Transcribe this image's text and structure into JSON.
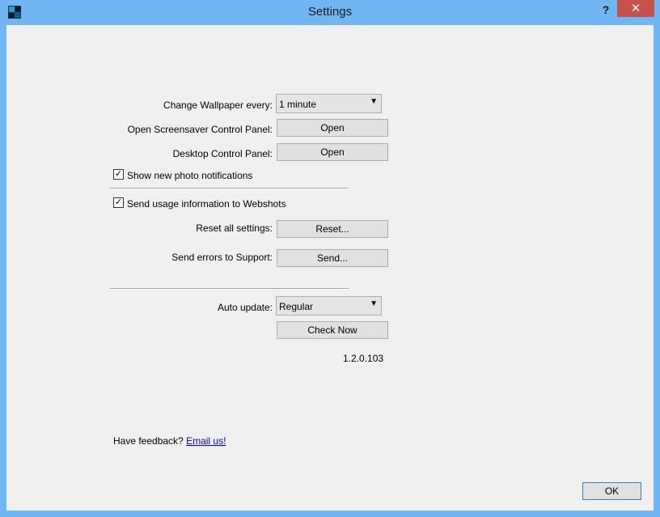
{
  "window": {
    "title": "Settings",
    "help_label": "?",
    "close_label": "✕"
  },
  "settings": {
    "wallpaper": {
      "label": "Change Wallpaper every:",
      "value": "1 minute"
    },
    "screensaver_panel": {
      "label": "Open Screensaver Control Panel:",
      "button": "Open"
    },
    "desktop_panel": {
      "label": "Desktop Control Panel:",
      "button": "Open"
    },
    "photo_notifications": {
      "label": "Show new photo notifications",
      "checked": true
    },
    "usage_info": {
      "label": "Send usage information to Webshots",
      "checked": true
    },
    "reset": {
      "label": "Reset all settings:",
      "button": "Reset..."
    },
    "send_errors": {
      "label": "Send errors to Support:",
      "button": "Send..."
    },
    "auto_update": {
      "label": "Auto update:",
      "value": "Regular"
    },
    "check_now": {
      "button": "Check Now"
    },
    "version": "1.2.0.103"
  },
  "feedback": {
    "text": "Have feedback?",
    "link": "Email us!"
  },
  "ok_button": "OK",
  "colors": {
    "titlebar": "#6fb6f2",
    "close": "#c7504b",
    "client": "#f0f0f0"
  }
}
